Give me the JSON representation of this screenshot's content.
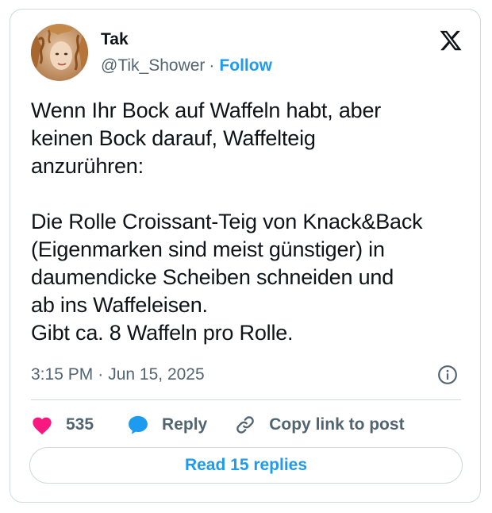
{
  "author": {
    "name": "Tak",
    "handle": "@Tik_Shower",
    "separator": "·",
    "follow_label": "Follow",
    "avatar_icon": "profile-photo-curly-hair"
  },
  "header": {
    "logo_icon": "x-logo-icon"
  },
  "tweet": {
    "text": "Wenn Ihr Bock auf Waffeln habt, aber\nkeinen Bock darauf, Waffelteig\nanzurühren:\n\nDie Rolle Croissant-Teig von Knack&Back\n(Eigenmarken sind meist günstiger) in\ndaumendicke Scheiben schneiden und\nab ins Waffeleisen.\nGibt ca. 8 Waffeln pro Rolle.",
    "time": "3:15 PM",
    "date_separator": "·",
    "date": "Jun 15, 2025",
    "info_icon": "info-icon"
  },
  "actions": {
    "like_count": "535",
    "like_icon": "heart-icon",
    "reply_label": "Reply",
    "reply_icon": "speech-bubble-icon",
    "copy_label": "Copy link to post",
    "copy_icon": "link-icon"
  },
  "footer": {
    "read_replies_label": "Read 15 replies"
  },
  "colors": {
    "accent": "#1d9bf0",
    "like": "#f91880",
    "text": "#0f1419",
    "muted": "#536471",
    "border": "#cfd9de"
  }
}
